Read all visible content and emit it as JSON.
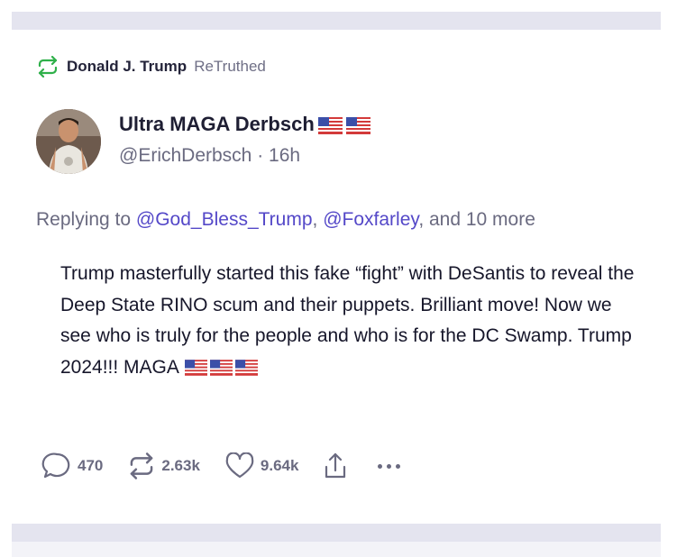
{
  "retruth": {
    "name": "Donald J. Trump",
    "action": "ReTruthed"
  },
  "post": {
    "display_name": "Ultra MAGA Derbsch",
    "handle": "@ErichDerbsch",
    "separator": " · ",
    "time": "16h",
    "reply_prefix": "Replying to ",
    "reply_user_1": "@God_Bless_Trump",
    "reply_comma": ", ",
    "reply_user_2": "@Foxfarley",
    "reply_suffix": ", and 10 more",
    "text": "Trump masterfully started this fake “fight” with DeSantis to reveal the Deep State RINO scum and their puppets. Brilliant move! Now we see who is truly for the people and who is for the DC Swamp. Trump 2024!!! MAGA"
  },
  "actions": {
    "replies": "470",
    "retruths": "2.63k",
    "likes": "9.64k"
  },
  "colors": {
    "retruth_icon": "#2fb04a",
    "link": "#5448c8",
    "muted": "#6a6a80"
  },
  "icons": [
    "retruth-icon",
    "reply-icon",
    "like-icon",
    "share-icon",
    "more-icon",
    "us-flag-icon"
  ]
}
